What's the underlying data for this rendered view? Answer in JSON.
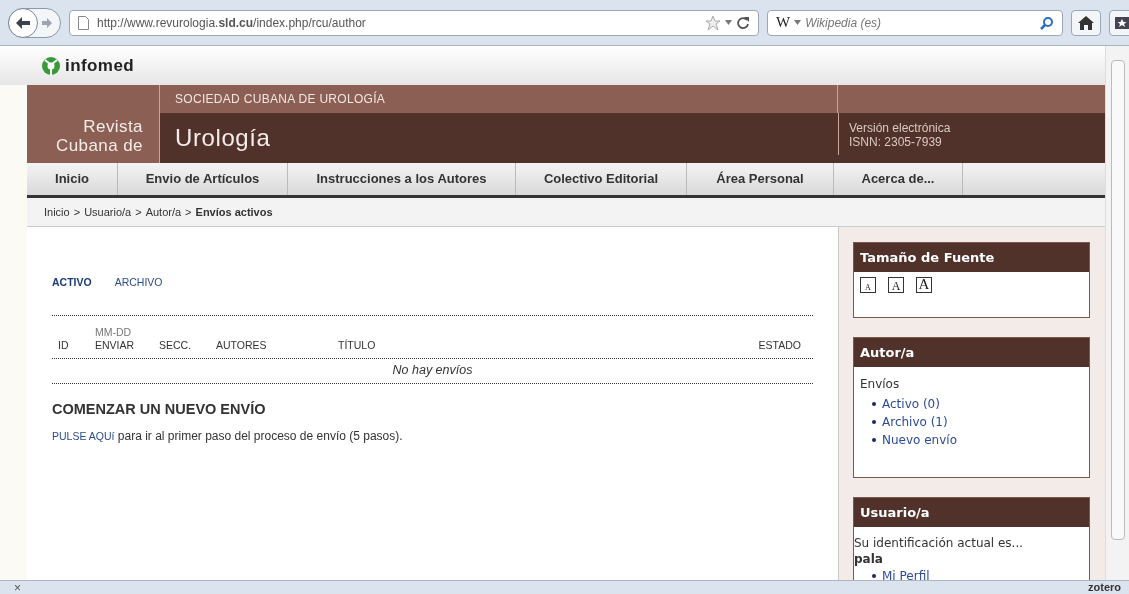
{
  "browser": {
    "url": "http://www.revurologia.**sld.cu**/index.php/rcu/author",
    "search_placeholder": "Wikipedia (es)",
    "search_engine": "W"
  },
  "site": {
    "brand": "infomed",
    "society": "SOCIEDAD CUBANA DE UROLOGÍA",
    "journal_prefix": [
      "Revista",
      "Cubana de"
    ],
    "journal_name": "Urología",
    "edition": [
      "Versión electrónica",
      "ISNN: 2305-7939"
    ]
  },
  "nav": [
    "Inicio",
    "Envio de Artículos",
    "Instrucciones a los Autores",
    "Colectivo Editorial",
    "Área Personal",
    "Acerca de..."
  ],
  "breadcrumb": [
    "Inicio",
    "Usuario/a",
    "Autor/a"
  ],
  "breadcrumb_separator": ">",
  "breadcrumb_current": "Envíos activos",
  "tabs": [
    {
      "label": "ACTIVO",
      "selected": true
    },
    {
      "label": "ARCHIVO",
      "selected": false
    }
  ],
  "table": {
    "columns": [
      {
        "label": "ID"
      },
      {
        "label": "ENVIAR",
        "sub": "MM-DD"
      },
      {
        "label": "SECC."
      },
      {
        "label": "AUTORES"
      },
      {
        "label": "TÍTULO"
      },
      {
        "label": "ESTADO"
      }
    ],
    "empty": "No hay envíos"
  },
  "new_submission": {
    "title": "COMENZAR UN NUEVO ENVÍO",
    "link": "PULSE AQUí",
    "text": "para ir al primer paso del proceso de envío (5 pasos)."
  },
  "sidebar": {
    "font_size": {
      "title": "Tamaño de Fuente",
      "sizes": [
        "A",
        "A",
        "A"
      ]
    },
    "author": {
      "title": "Autor/a",
      "label": "Envíos",
      "links": [
        "Activo (0)",
        "Archivo (1)",
        "Nuevo envío"
      ]
    },
    "user": {
      "title": "Usuario/a",
      "text": "Su identificación actual es...",
      "username": "pala",
      "links": [
        "Mi Perfil"
      ]
    }
  },
  "status_bar": {
    "close": "×",
    "addon": "zotero"
  }
}
